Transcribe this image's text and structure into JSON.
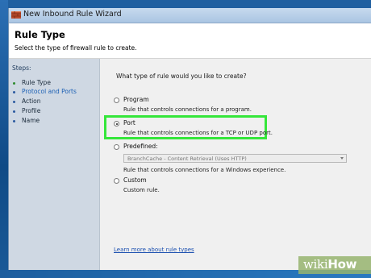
{
  "window": {
    "title": "New Inbound Rule Wizard"
  },
  "header": {
    "title": "Rule Type",
    "subtitle": "Select the type of firewall rule to create."
  },
  "steps": {
    "title": "Steps:",
    "items": [
      {
        "label": "Rule Type",
        "state": "done"
      },
      {
        "label": "Protocol and Ports",
        "state": "current"
      },
      {
        "label": "Action",
        "state": "pending"
      },
      {
        "label": "Profile",
        "state": "pending"
      },
      {
        "label": "Name",
        "state": "pending"
      }
    ]
  },
  "main": {
    "question": "What type of rule would you like to create?",
    "options": {
      "program": {
        "label": "Program",
        "desc": "Rule that controls connections for a program.",
        "selected": false
      },
      "port": {
        "label": "Port",
        "desc": "Rule that controls connections for a TCP or UDP port.",
        "selected": true
      },
      "predefined": {
        "label": "Predefined:",
        "desc": "Rule that controls connections for a Windows experience.",
        "selected": false,
        "select_value": "BranchCache - Content Retrieval (Uses HTTP)"
      },
      "custom": {
        "label": "Custom",
        "desc": "Custom rule.",
        "selected": false
      }
    },
    "link": "Learn more about rule types"
  },
  "watermark": {
    "prefix": "wiki",
    "suffix": "How"
  },
  "colors": {
    "highlight": "#35e63a",
    "link": "#1a4fb0",
    "steps_bg": "#cfd8e3"
  }
}
